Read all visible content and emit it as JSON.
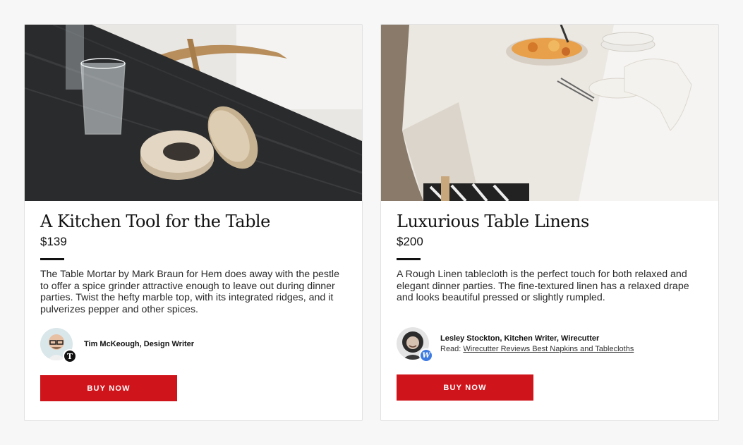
{
  "cards": [
    {
      "title": "A Kitchen Tool for the Table",
      "price": "$139",
      "description": "The Table Mortar by Mark Braun for Hem does away with the pestle to offer a spice grinder attractive enough to leave out during dinner parties. Twist the hefty marble top, with its integrated ridges, and it pulverizes pepper and other spices.",
      "author": {
        "name": "Tim McKeough, Design Writer",
        "badge": "T"
      },
      "button_label": "BUY NOW"
    },
    {
      "title": "Luxurious Table Linens",
      "price": "$200",
      "description": "A Rough Linen tablecloth is the perfect touch for both relaxed and elegant dinner parties. The fine-textured linen has a relaxed drape and looks beautiful pressed or slightly rumpled.",
      "author": {
        "name": "Lesley Stockton, Kitchen Writer, Wirecutter",
        "read_prefix": "Read:",
        "read_link": "Wirecutter Reviews Best Napkins and Tablecloths",
        "badge": "W"
      },
      "button_label": "BUY NOW"
    }
  ],
  "colors": {
    "button": "#d0141b",
    "wirecutter_badge": "#3d7be0"
  }
}
